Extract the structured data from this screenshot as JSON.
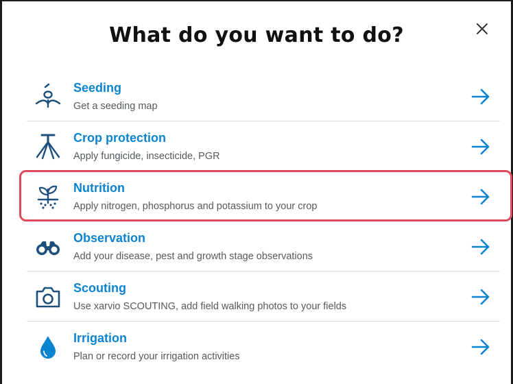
{
  "dialog": {
    "title": "What do you want to do?",
    "close_icon": "close-icon",
    "options": [
      {
        "id": "seeding",
        "label": "Seeding",
        "description": "Get a seeding map",
        "icon": "seeding-icon"
      },
      {
        "id": "crop-protection",
        "label": "Crop protection",
        "description": "Apply fungicide, insecticide, PGR",
        "icon": "sprayer-icon"
      },
      {
        "id": "nutrition",
        "label": "Nutrition",
        "description": "Apply nitrogen, phosphorus and potassium to your crop",
        "icon": "fertilizer-plant-icon",
        "highlighted": true
      },
      {
        "id": "observation",
        "label": "Observation",
        "description": "Add your disease, pest and growth stage observations",
        "icon": "binoculars-icon"
      },
      {
        "id": "scouting",
        "label": "Scouting",
        "description": "Use xarvio SCOUTING, add field walking photos to your fields",
        "icon": "camera-icon"
      },
      {
        "id": "irrigation",
        "label": "Irrigation",
        "description": "Plan or record your irrigation activities",
        "icon": "water-drop-icon"
      }
    ]
  },
  "colors": {
    "accent": "#0a84d0",
    "icon": "#1d4f7c",
    "highlight_border": "#e14a5d",
    "divider": "#dadde0"
  }
}
